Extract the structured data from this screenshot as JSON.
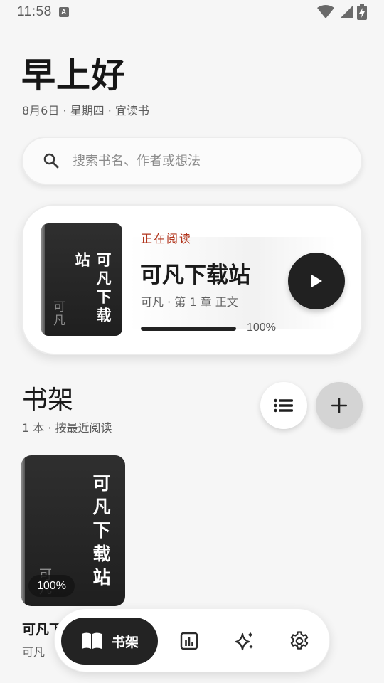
{
  "status_bar": {
    "time": "11:58",
    "notification_letter": "A"
  },
  "greeting": "早上好",
  "date_line": "8月6日 · 星期四 · 宜读书",
  "search": {
    "placeholder": "搜索书名、作者或想法"
  },
  "current_reading": {
    "label": "正在阅读",
    "title": "可凡下载站",
    "meta": "可凡 · 第 1 章 正文",
    "progress": 1.0,
    "progress_text": "100%",
    "cover": {
      "title": "可凡下载站",
      "author": "可凡"
    }
  },
  "shelf": {
    "title": "书架",
    "subtitle": "1 本 · 按最近阅读",
    "books": [
      {
        "cover_title": "可凡下载站",
        "cover_author": "可凡",
        "progress_badge": "100%",
        "title": "可凡下",
        "author": "可凡"
      }
    ]
  },
  "bottom_nav": {
    "active_label": "书架",
    "items": [
      "bookshelf-icon",
      "stats-icon",
      "sparkles-icon",
      "gear-icon"
    ]
  },
  "colors": {
    "accent_red": "#b2361e",
    "dark": "#212121",
    "background": "#f6f6f6"
  }
}
